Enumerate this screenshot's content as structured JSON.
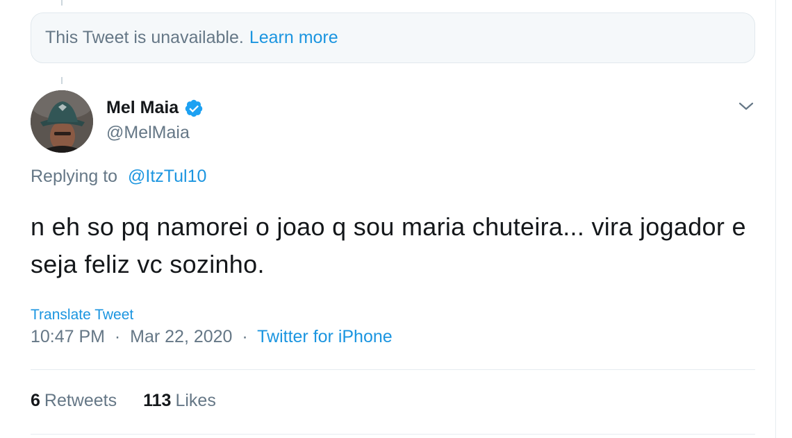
{
  "unavailable": {
    "message": "This Tweet is unavailable.",
    "link": "Learn more"
  },
  "author": {
    "display_name": "Mel Maia",
    "handle": "@MelMaia",
    "verified": true
  },
  "reply": {
    "prefix": "Replying to",
    "mention": "@ItzTul10"
  },
  "tweet": {
    "text": "n eh so pq namorei o joao q sou maria chuteira... vira jogador e seja feliz vc sozinho.",
    "translate_label": "Translate Tweet",
    "time": "10:47 PM",
    "date": "Mar 22, 2020",
    "separator": "·",
    "source": "Twitter for iPhone"
  },
  "stats": {
    "retweets_count": "6",
    "retweets_label": "Retweets",
    "likes_count": "113",
    "likes_label": "Likes"
  },
  "colors": {
    "link": "#1b95e0",
    "secondary_text": "#657786",
    "primary_text": "#14171a",
    "verified": "#1da1f2"
  },
  "icons": {
    "verified": "verified-badge-icon",
    "caret": "chevron-down-icon"
  }
}
